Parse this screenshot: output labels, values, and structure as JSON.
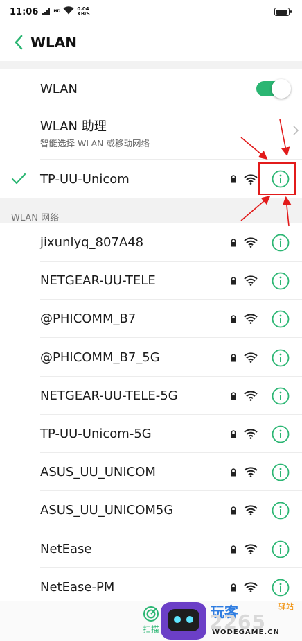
{
  "status_bar": {
    "time": "11:06",
    "hd_label": "HD",
    "speed_value": "0.04",
    "speed_unit": "KB/S"
  },
  "header": {
    "title": "WLAN"
  },
  "wlan_toggle": {
    "label": "WLAN",
    "on": true
  },
  "assistant": {
    "title": "WLAN 助理",
    "subtitle": "智能选择 WLAN 或移动网络"
  },
  "connected": {
    "ssid": "TP-UU-Unicom"
  },
  "section": {
    "label": "WLAN 网络"
  },
  "networks": [
    {
      "ssid": "jixunlyq_807A48"
    },
    {
      "ssid": "NETGEAR-UU-TELE"
    },
    {
      "ssid": "@PHICOMM_B7"
    },
    {
      "ssid": "@PHICOMM_B7_5G"
    },
    {
      "ssid": "NETGEAR-UU-TELE-5G"
    },
    {
      "ssid": "TP-UU-Unicom-5G"
    },
    {
      "ssid": "ASUS_UU_UNICOM"
    },
    {
      "ssid": "ASUS_UU_UNICOM5G"
    },
    {
      "ssid": "NetEase"
    },
    {
      "ssid": "NetEase-PM"
    }
  ],
  "bottom_bar": {
    "scan_label": "扫描"
  },
  "watermark": {
    "brand": "玩客",
    "brand_suffix": "驿站",
    "big_text": "2265",
    "domain": "WODEGAME.CN"
  },
  "icons": {
    "back": "chevron-left-icon",
    "check": "check-icon",
    "lock": "lock-icon",
    "wifi": "wifi-icon",
    "info": "info-icon",
    "scan": "scan-icon"
  },
  "colors": {
    "accent": "#2bb673",
    "annotation_red": "#e21b1b",
    "section_bg": "#f2f2f2"
  }
}
